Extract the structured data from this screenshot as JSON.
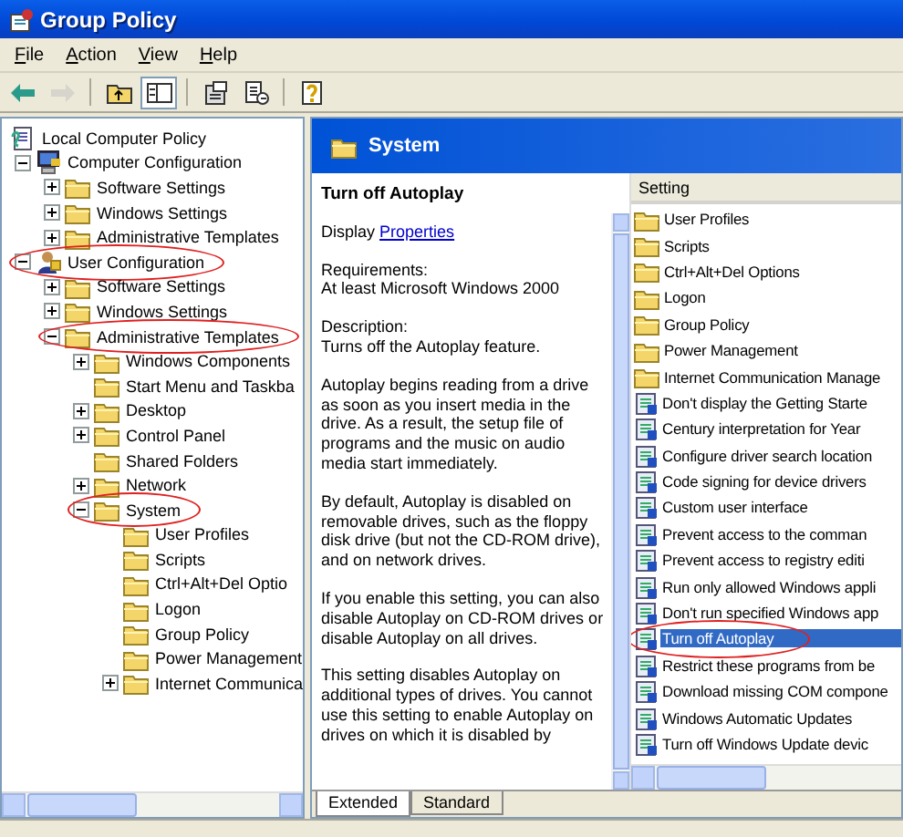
{
  "window": {
    "title": "Group Policy"
  },
  "menu": [
    {
      "label": "File"
    },
    {
      "label": "Action"
    },
    {
      "label": "View"
    },
    {
      "label": "Help"
    }
  ],
  "toolbar": [
    {
      "kind": "back",
      "disabled": false,
      "pressed": false
    },
    {
      "kind": "forward",
      "disabled": true,
      "pressed": false
    },
    {
      "kind": "separator"
    },
    {
      "kind": "up",
      "disabled": false,
      "pressed": false
    },
    {
      "kind": "tree",
      "disabled": false,
      "pressed": true
    },
    {
      "kind": "separator"
    },
    {
      "kind": "properties",
      "disabled": false,
      "pressed": false
    },
    {
      "kind": "export",
      "disabled": false,
      "pressed": false
    },
    {
      "kind": "separator"
    },
    {
      "kind": "help",
      "disabled": false,
      "pressed": false
    }
  ],
  "tree": [
    {
      "label": "Local Computer Policy",
      "kind": "policy",
      "annotated": false,
      "children": [
        {
          "label": "Computer Configuration",
          "kind": "computer",
          "expanded": true,
          "annotated": false,
          "children": [
            {
              "label": "Software Settings",
              "kind": "folder",
              "expanded": false,
              "annotated": false
            },
            {
              "label": "Windows Settings",
              "kind": "folder",
              "expanded": false,
              "annotated": false
            },
            {
              "label": "Administrative Templates",
              "kind": "folder",
              "expanded": false,
              "annotated": false
            }
          ]
        },
        {
          "label": "User Configuration",
          "kind": "user",
          "expanded": true,
          "annotated": true,
          "children": [
            {
              "label": "Software Settings",
              "kind": "folder",
              "expanded": false,
              "annotated": false
            },
            {
              "label": "Windows Settings",
              "kind": "folder",
              "expanded": false,
              "annotated": false
            },
            {
              "label": "Administrative Templates",
              "kind": "folder",
              "expanded": true,
              "annotated": true,
              "children": [
                {
                  "label": "Windows Components",
                  "kind": "folder",
                  "expanded": false,
                  "annotated": false
                },
                {
                  "label": "Start Menu and Taskba",
                  "kind": "folder",
                  "annotated": false
                },
                {
                  "label": "Desktop",
                  "kind": "folder",
                  "expanded": false,
                  "annotated": false
                },
                {
                  "label": "Control Panel",
                  "kind": "folder",
                  "expanded": false,
                  "annotated": false
                },
                {
                  "label": "Shared Folders",
                  "kind": "folder",
                  "annotated": false
                },
                {
                  "label": "Network",
                  "kind": "folder",
                  "expanded": false,
                  "annotated": false
                },
                {
                  "label": "System",
                  "kind": "folder",
                  "expanded": true,
                  "annotated": true,
                  "children": [
                    {
                      "label": "User Profiles",
                      "kind": "folder",
                      "annotated": false
                    },
                    {
                      "label": "Scripts",
                      "kind": "folder",
                      "annotated": false
                    },
                    {
                      "label": "Ctrl+Alt+Del Optio",
                      "kind": "folder",
                      "annotated": false
                    },
                    {
                      "label": "Logon",
                      "kind": "folder",
                      "annotated": false
                    },
                    {
                      "label": "Group Policy",
                      "kind": "folder",
                      "annotated": false
                    },
                    {
                      "label": "Power Management",
                      "kind": "folder",
                      "annotated": false
                    },
                    {
                      "label": "Internet Communica",
                      "kind": "folder",
                      "expanded": false,
                      "annotated": false
                    }
                  ]
                }
              ]
            }
          ]
        }
      ]
    }
  ],
  "header": {
    "title": "System"
  },
  "description": {
    "title": "Turn off Autoplay",
    "display_label": "Display",
    "display_link": "Properties",
    "paragraphs": [
      "Requirements:\nAt least Microsoft Windows 2000",
      "Description:\nTurns off the Autoplay feature.",
      "Autoplay begins reading from a drive as soon as you insert media in the drive. As a result, the setup file of programs and the music on audio media start immediately.",
      "By default, Autoplay is disabled on removable drives, such as the floppy disk drive (but not the CD-ROM drive), and on network drives.",
      "If you enable this setting, you can also disable Autoplay on CD-ROM drives or disable Autoplay on all drives.",
      "This setting disables Autoplay on additional types of drives. You cannot use this setting to enable Autoplay on drives on which it is disabled by"
    ]
  },
  "list": {
    "column": "Setting",
    "items": [
      {
        "label": "User Profiles",
        "kind": "folder",
        "selected": false,
        "annotated": false
      },
      {
        "label": "Scripts",
        "kind": "folder",
        "selected": false,
        "annotated": false
      },
      {
        "label": "Ctrl+Alt+Del Options",
        "kind": "folder",
        "selected": false,
        "annotated": false
      },
      {
        "label": "Logon",
        "kind": "folder",
        "selected": false,
        "annotated": false
      },
      {
        "label": "Group Policy",
        "kind": "folder",
        "selected": false,
        "annotated": false
      },
      {
        "label": "Power Management",
        "kind": "folder",
        "selected": false,
        "annotated": false
      },
      {
        "label": "Internet Communication Manage",
        "kind": "folder",
        "selected": false,
        "annotated": false
      },
      {
        "label": "Don't display the Getting Starte",
        "kind": "setting",
        "selected": false,
        "annotated": false
      },
      {
        "label": "Century interpretation for Year",
        "kind": "setting",
        "selected": false,
        "annotated": false
      },
      {
        "label": "Configure driver search location",
        "kind": "setting",
        "selected": false,
        "annotated": false
      },
      {
        "label": "Code signing for device drivers",
        "kind": "setting",
        "selected": false,
        "annotated": false
      },
      {
        "label": "Custom user interface",
        "kind": "setting",
        "selected": false,
        "annotated": false
      },
      {
        "label": "Prevent access to the comman",
        "kind": "setting",
        "selected": false,
        "annotated": false
      },
      {
        "label": "Prevent access to registry editi",
        "kind": "setting",
        "selected": false,
        "annotated": false
      },
      {
        "label": "Run only allowed Windows appli",
        "kind": "setting",
        "selected": false,
        "annotated": false
      },
      {
        "label": "Don't run specified Windows app",
        "kind": "setting",
        "selected": false,
        "annotated": false
      },
      {
        "label": "Turn off Autoplay",
        "kind": "setting",
        "selected": true,
        "annotated": true
      },
      {
        "label": "Restrict these programs from be",
        "kind": "setting",
        "selected": false,
        "annotated": false
      },
      {
        "label": "Download missing COM compone",
        "kind": "setting",
        "selected": false,
        "annotated": false
      },
      {
        "label": "Windows Automatic Updates",
        "kind": "setting",
        "selected": false,
        "annotated": false
      },
      {
        "label": "Turn off Windows Update devic",
        "kind": "setting",
        "selected": false,
        "annotated": false
      }
    ]
  },
  "tabs": [
    {
      "label": "Extended",
      "selected": true
    },
    {
      "label": "Standard",
      "selected": false
    }
  ]
}
